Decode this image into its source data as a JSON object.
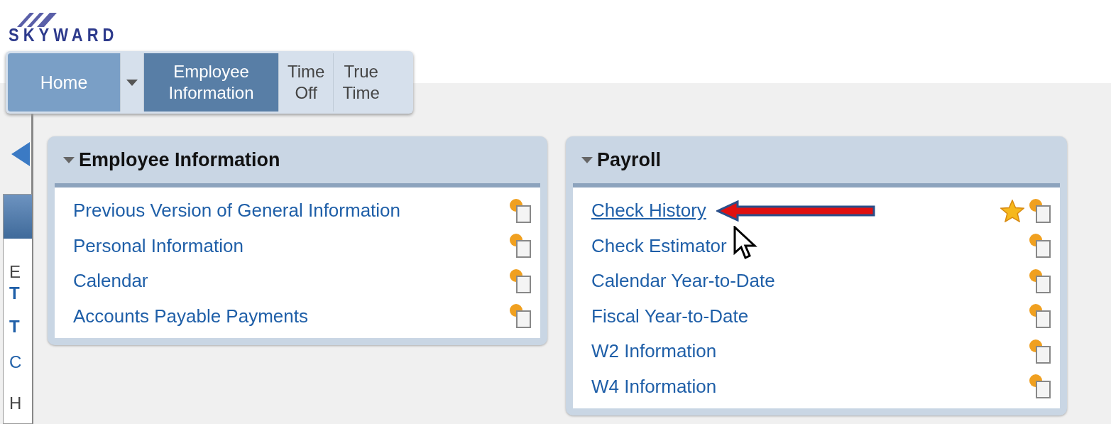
{
  "logo": {
    "text": "SKYWARD"
  },
  "tabs": [
    {
      "label": "Home",
      "kind": "home",
      "selected": false
    },
    {
      "kind": "dropdown",
      "selected": false
    },
    {
      "label": "Employee Information",
      "kind": "tab",
      "selected": true
    },
    {
      "label": "Time Off",
      "kind": "tab",
      "selected": false
    },
    {
      "label": "True Time",
      "kind": "tab",
      "selected": false
    }
  ],
  "side_panel": {
    "letters": [
      "E",
      "T",
      "T",
      "C",
      "H"
    ]
  },
  "panels": [
    {
      "title": "Employee Information",
      "expanded": true,
      "items": [
        {
          "label": "Previous Version of General Information",
          "favorite": false
        },
        {
          "label": "Personal Information",
          "favorite": false
        },
        {
          "label": "Calendar",
          "favorite": false
        },
        {
          "label": "Accounts Payable Payments",
          "favorite": false
        }
      ]
    },
    {
      "title": "Payroll",
      "expanded": true,
      "items": [
        {
          "label": "Check History",
          "favorite": true,
          "annotated": true
        },
        {
          "label": "Check Estimator",
          "favorite": false
        },
        {
          "label": "Calendar Year-to-Date",
          "favorite": false
        },
        {
          "label": "Fiscal Year-to-Date",
          "favorite": false
        },
        {
          "label": "W2 Information",
          "favorite": false
        },
        {
          "label": "W4 Information",
          "favorite": false
        }
      ]
    }
  ]
}
